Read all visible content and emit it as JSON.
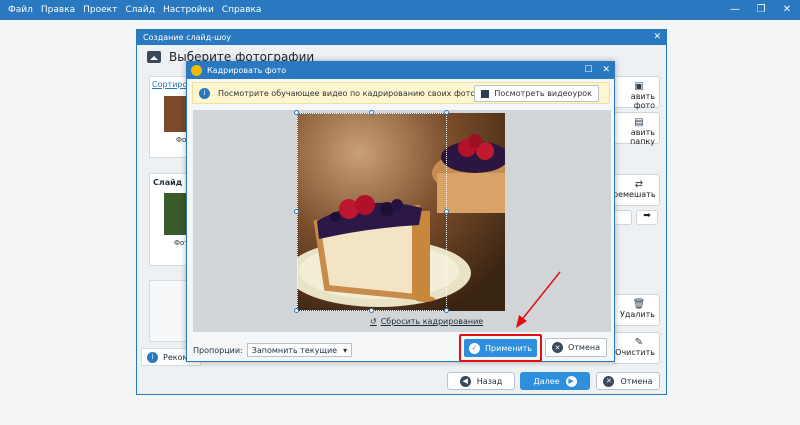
{
  "app": {
    "menu": [
      "Файл",
      "Правка",
      "Проект",
      "Слайд",
      "Настройки",
      "Справка"
    ]
  },
  "slideshow_dialog": {
    "title": "Создание слайд-шоу",
    "heading": "Выберите фотографии",
    "sort_link": "Сортирова",
    "thumb_label_1": "Фо",
    "slide_label": "Слайд",
    "thumb_label_2": "Фот",
    "recommend_text": "Рекоме",
    "right_buttons": {
      "add_photo": "авить фото",
      "add_folder": "авить папку",
      "shuffle": "ремешать",
      "delete": "Удалить",
      "clear": "Очистить"
    },
    "nav": {
      "back": "Назад",
      "next": "Далее",
      "cancel": "Отмена"
    }
  },
  "crop_dialog": {
    "title": "Кадрировать фото",
    "info_text": "Посмотрите обучающее видео по кадрированию своих фото...",
    "video_button": "Посмотреть видеоурок",
    "reset_link": "Сбросить кадрирование",
    "proportions_label": "Пропорции:",
    "proportions_value": "Запомнить текущие",
    "apply_button": "Применить",
    "cancel_button": "Отмена"
  },
  "colors": {
    "accent": "#2a78bf",
    "apply": "#2d8fde",
    "highlight": "#e01010",
    "info_bg": "#fdf6cf"
  }
}
